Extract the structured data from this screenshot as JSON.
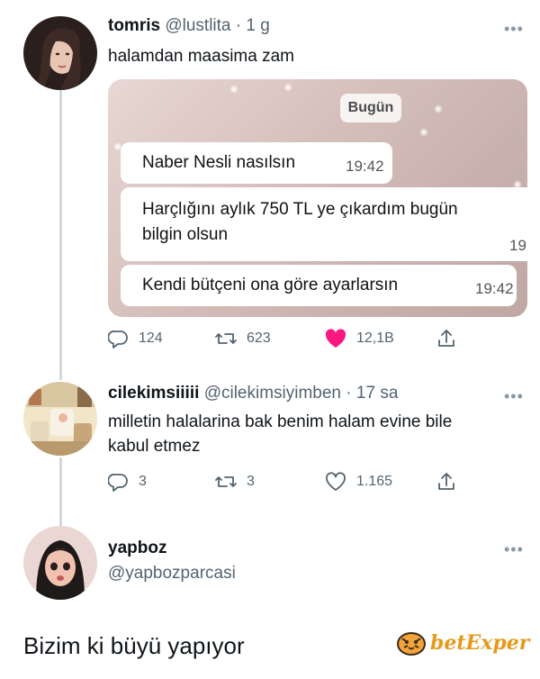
{
  "tweet1": {
    "name": "tomris",
    "handle": "@lustlita",
    "time": "1 g",
    "text": "halamdan maasima zam",
    "media": {
      "date_chip": "Bugün",
      "messages": [
        {
          "text": "Naber Nesli nasılsın",
          "time": "19:42"
        },
        {
          "line1": "Harçlığını aylık 750 TL ye çıkardım bugün",
          "line2": "bilgin olsun",
          "time": "19"
        },
        {
          "text": "Kendi bütçeni ona göre ayarlarsın",
          "time": "19:42"
        }
      ]
    },
    "actions": {
      "replies": "124",
      "retweets": "623",
      "likes": "12,1B"
    }
  },
  "tweet2": {
    "name": "cilekimsiiiii",
    "handle": "@cilekimsiyimben",
    "time": "17 sa",
    "line1": "milletin halalarina bak benim halam evine bile",
    "line2": "kabul etmez",
    "actions": {
      "replies": "3",
      "retweets": "3",
      "likes": "1.165"
    }
  },
  "tweet3": {
    "name": "yapboz",
    "handle": "@yapbozparcasi"
  },
  "separator": "·",
  "more_glyph": "•••",
  "caption": "Bizim ki büyü yapıyor",
  "watermark": "betExper",
  "colors": {
    "like_pink": "#f91880",
    "muted": "#536471",
    "thread_line": "#cfd9de",
    "watermark": "#e69a1c"
  }
}
